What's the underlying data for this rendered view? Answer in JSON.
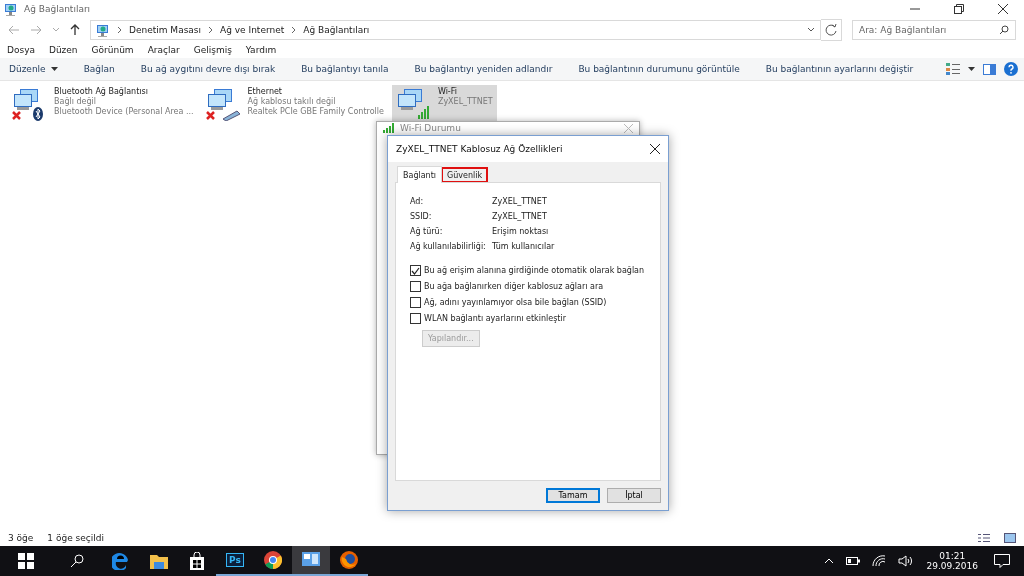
{
  "window": {
    "title": "Ağ Bağlantıları"
  },
  "address_bar": {
    "path": [
      "Denetim Masası",
      "Ağ ve Internet",
      "Ağ Bağlantıları"
    ]
  },
  "search": {
    "placeholder": "Ara: Ağ Bağlantıları"
  },
  "menu": [
    "Dosya",
    "Düzen",
    "Görünüm",
    "Araçlar",
    "Gelişmiş",
    "Yardım"
  ],
  "commands": [
    {
      "label": "Düzenle",
      "kind": "dropdown"
    },
    {
      "label": "Bağlan",
      "kind": "plain"
    },
    {
      "label": "Bu ağ aygıtını devre dışı bırak",
      "kind": "plain"
    },
    {
      "label": "Bu bağlantıyı tanıla",
      "kind": "plain"
    },
    {
      "label": "Bu bağlantıyı yeniden adlandır",
      "kind": "plain"
    },
    {
      "label": "Bu bağlantının durumunu görüntüle",
      "kind": "plain"
    },
    {
      "label": "Bu bağlantının ayarlarını değiştir",
      "kind": "plain"
    }
  ],
  "connections": [
    {
      "name": "Bluetooth Ağ Bağlantısı",
      "status": "Bağlı değil",
      "device": "Bluetooth Device (Personal Area ...",
      "kind": "bluetooth",
      "disconnected": true,
      "selected": false
    },
    {
      "name": "Ethernet",
      "status": "Ağ kablosu takılı değil",
      "device": "Realtek PCIe GBE Family Controlle",
      "kind": "ethernet",
      "disconnected": true,
      "selected": false
    },
    {
      "name": "Wi-Fi",
      "status": "ZyXEL_TTNET",
      "kind": "wifi",
      "disconnected": false,
      "selected": true
    }
  ],
  "status_dialog": {
    "title": "Wi-Fi Durumu"
  },
  "properties_dialog": {
    "title": "ZyXEL_TTNET Kablosuz Ağ Özellikleri",
    "tabs": [
      {
        "label": "Bağlantı",
        "selected": true,
        "highlighted": false
      },
      {
        "label": "Güvenlik",
        "selected": false,
        "highlighted": true
      }
    ],
    "fields": [
      {
        "label": "Ad:",
        "value": "ZyXEL_TTNET"
      },
      {
        "label": "SSID:",
        "value": "ZyXEL_TTNET"
      },
      {
        "label": "Ağ türü:",
        "value": "Erişim noktası"
      },
      {
        "label": "Ağ kullanılabilirliği:",
        "value": "Tüm kullanıcılar"
      }
    ],
    "options": [
      {
        "label": "Bu ağ erişim alanına girdiğinde otomatik olarak bağlan",
        "checked": true
      },
      {
        "label": "Bu ağa bağlanırken diğer kablosuz ağları ara",
        "checked": false
      },
      {
        "label": "Ağ, adını yayınlamıyor olsa bile bağlan (SSID)",
        "checked": false
      },
      {
        "label": "WLAN bağlantı ayarlarını etkinleştir",
        "checked": false
      }
    ],
    "configure_button": {
      "label": "Yapılandır...",
      "disabled": true
    },
    "buttons": [
      {
        "label": "Tamam",
        "default": true
      },
      {
        "label": "İptal",
        "default": false
      }
    ]
  },
  "status_bar": {
    "items": [
      "3 öğe",
      "1 öğe seçildi"
    ]
  },
  "taskbar": {
    "apps": [
      {
        "kind": "edge",
        "running": false,
        "selected": false
      },
      {
        "kind": "explorer",
        "running": false,
        "selected": false
      },
      {
        "kind": "store",
        "running": false,
        "selected": false
      },
      {
        "kind": "photoshop",
        "label": "Ps",
        "running": true,
        "selected": false
      },
      {
        "kind": "chrome",
        "running": true,
        "selected": false
      },
      {
        "kind": "control",
        "running": true,
        "selected": true
      },
      {
        "kind": "firefox",
        "running": true,
        "selected": false
      }
    ],
    "time": "01:21",
    "date": "29.09.2016"
  }
}
